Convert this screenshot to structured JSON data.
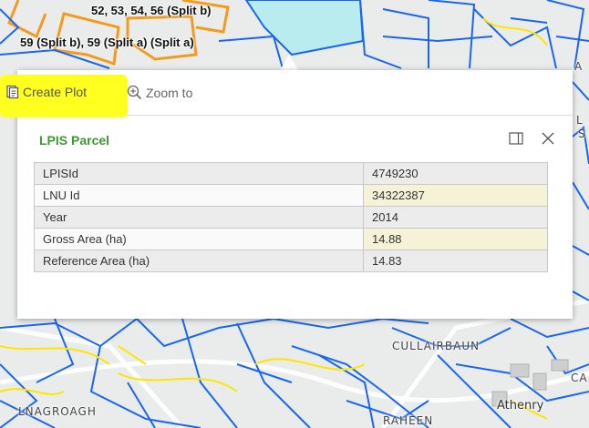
{
  "map": {
    "labels": {
      "split_top": "52, 53, 54, 56 (Split b)",
      "split_mid": "59 (Split b), 59 (Split a) (Split a)",
      "townland_1": "CULLAIRBAUN",
      "townland_2": "LNAGROAGH",
      "townland_3": "RAHEEN",
      "town": "Athenry",
      "edge_a": "A",
      "edge_l": "L",
      "edge_s": "S",
      "edge_ca": "CA"
    },
    "colors": {
      "parcel_line": "#1a66ee",
      "selected_fill": "#b8ecef",
      "plot_outline": "#f39a1f",
      "road": "#ffe600",
      "background": "#e9eceb"
    }
  },
  "popup": {
    "actions": {
      "create_plot": "Create Plot",
      "zoom_to": "Zoom to"
    },
    "title": "LPIS Parcel",
    "rows": [
      {
        "key": "LPISId",
        "value": "4749230"
      },
      {
        "key": "LNU Id",
        "value": "34322387"
      },
      {
        "key": "Year",
        "value": "2014"
      },
      {
        "key": "Gross Area (ha)",
        "value": "14.88"
      },
      {
        "key": "Reference Area (ha)",
        "value": "14.83"
      }
    ],
    "title_color": "#3a9a2b"
  }
}
